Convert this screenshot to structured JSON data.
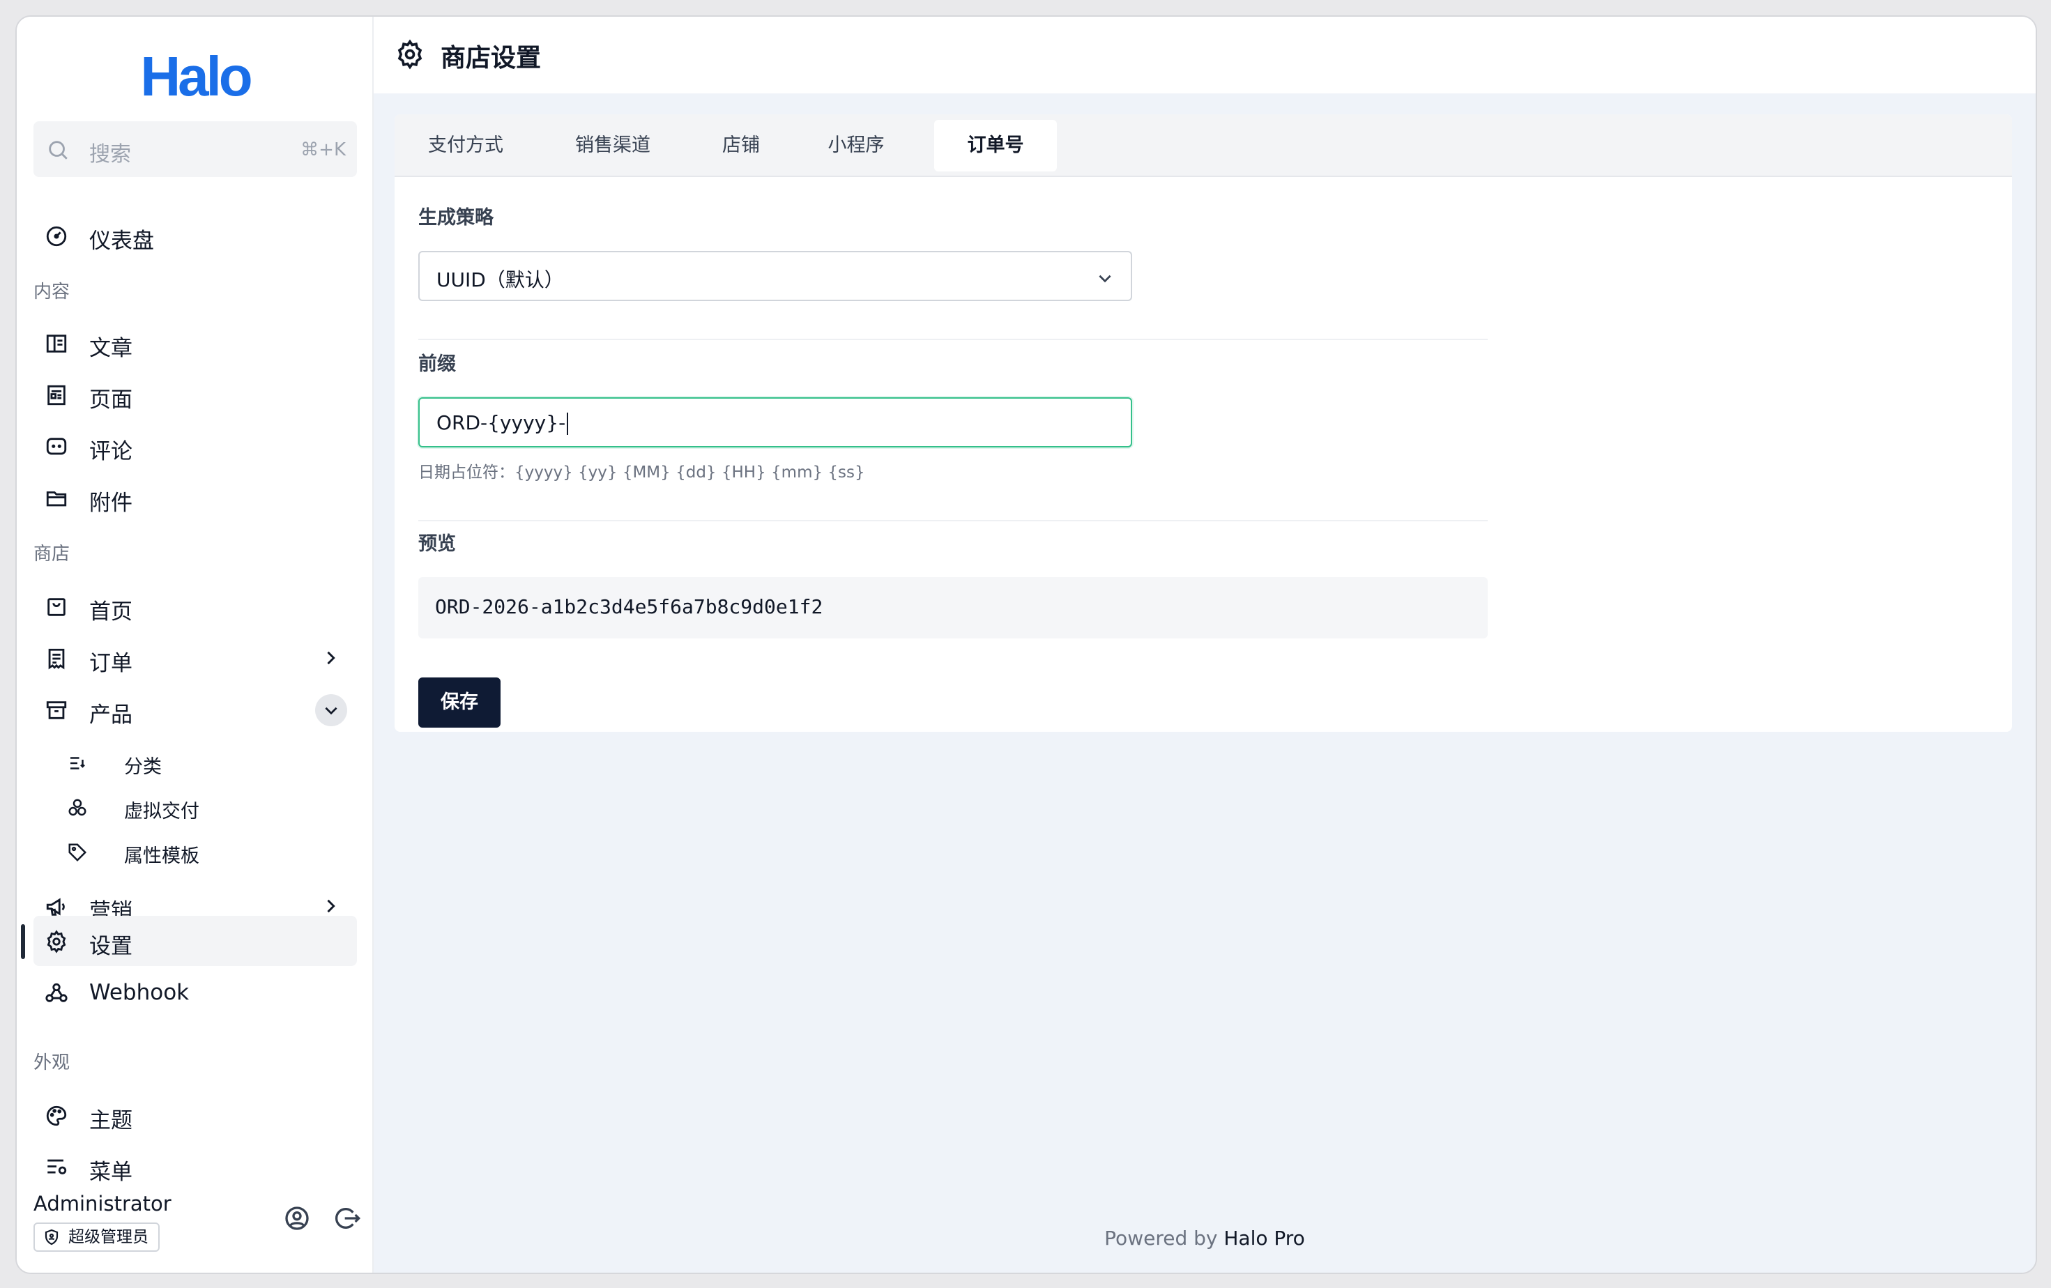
{
  "app": {
    "logo": "Halo"
  },
  "search": {
    "placeholder": "搜索",
    "shortcut": "⌘+K"
  },
  "sidebar": {
    "dashboard": "仪表盘",
    "groups": {
      "content": "内容",
      "shop": "商店",
      "appearance": "外观"
    },
    "content_items": [
      "文章",
      "页面",
      "评论",
      "附件"
    ],
    "shop_items": {
      "home": "首页",
      "orders": "订单",
      "products": "产品",
      "product_sub": [
        "分类",
        "虚拟交付",
        "属性模板"
      ],
      "marketing": "营销",
      "settings": "设置",
      "webhook": "Webhook"
    },
    "appearance_items": [
      "主题",
      "菜单"
    ],
    "active_item": "设置"
  },
  "user": {
    "name": "Administrator",
    "role": "超级管理员"
  },
  "header": {
    "title": "商店设置",
    "icon": "gear-icon"
  },
  "tabs": [
    {
      "label": "支付方式",
      "active": false
    },
    {
      "label": "销售渠道",
      "active": false
    },
    {
      "label": "店铺",
      "active": false
    },
    {
      "label": "小程序",
      "active": false
    },
    {
      "label": "订单号",
      "active": true
    }
  ],
  "form": {
    "strategy": {
      "label": "生成策略",
      "value": "UUID（默认）"
    },
    "prefix": {
      "label": "前缀",
      "value": "ORD-{yyyy}-",
      "help": "日期占位符：{yyyy} {yy} {MM} {dd} {HH} {mm} {ss}"
    },
    "preview": {
      "label": "预览",
      "value": "ORD-2026-a1b2c3d4e5f6a7b8c9d0e1f2"
    },
    "save_label": "保存"
  },
  "footer": {
    "prefix": "Powered by ",
    "brand": "Halo Pro"
  },
  "colors": {
    "accent": "#1a6ee8",
    "focus": "#34c08a",
    "primary_button": "#0f1b34"
  }
}
